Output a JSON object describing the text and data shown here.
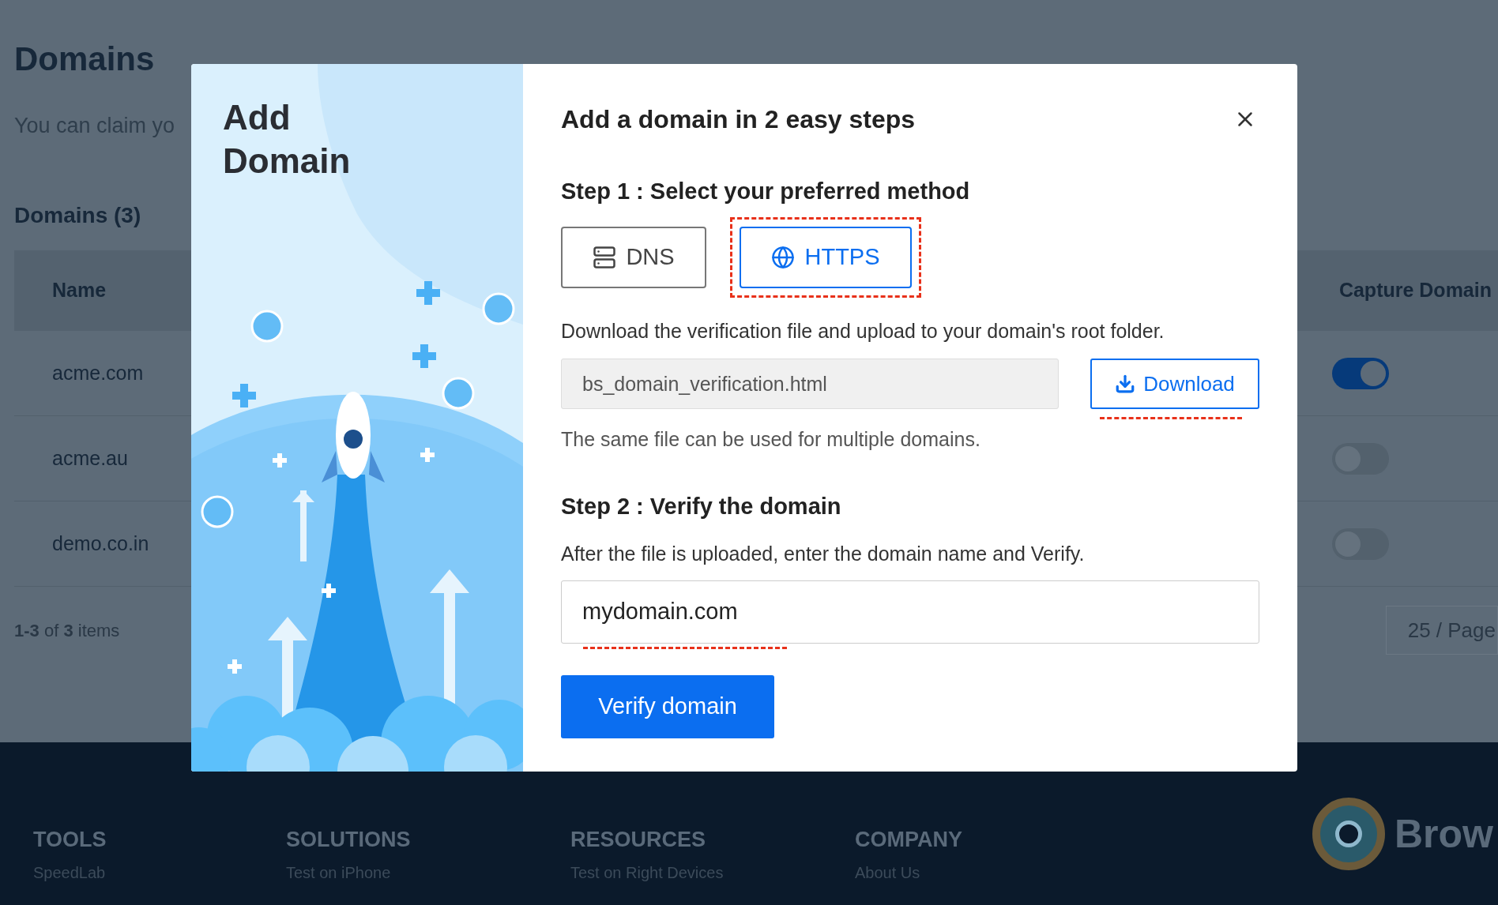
{
  "page": {
    "title": "Domains",
    "intro": "You can claim yo",
    "section_title": "Domains (3)"
  },
  "table": {
    "columns": [
      "Name",
      "Capture Domain"
    ],
    "rows": [
      {
        "name": "acme.com",
        "capture_on": true
      },
      {
        "name": "acme.au",
        "capture_on": false
      },
      {
        "name": "demo.co.in",
        "capture_on": false
      }
    ]
  },
  "pagination": {
    "summary": "**1-3** of **3** items",
    "page_size": "25 / Page"
  },
  "footer": {
    "columns": [
      {
        "heading": "TOOLS",
        "link": "SpeedLab"
      },
      {
        "heading": "SOLUTIONS",
        "link": "Test on iPhone"
      },
      {
        "heading": "RESOURCES",
        "link": "Test on Right Devices"
      },
      {
        "heading": "COMPANY",
        "link": "About Us"
      }
    ],
    "brand": "Brow"
  },
  "dialog": {
    "side_title": "Add Domain",
    "title": "Add a domain in 2 easy steps",
    "step1": {
      "title": "Step 1 : Select your preferred method",
      "methods": [
        {
          "label": "DNS",
          "kind": "server",
          "selected": false
        },
        {
          "label": "HTTPS",
          "kind": "globe",
          "selected": true
        }
      ],
      "description": "Download the verification file and upload to your domain's root folder.",
      "file_name": "bs_domain_verification.html",
      "download_button": "Download",
      "note": "The same file can be used for multiple domains."
    },
    "step2": {
      "title": "Step 2 : Verify the domain",
      "description": "After the file is uploaded, enter the domain name and Verify.",
      "domain_value": "mydomain.com",
      "verify_button": "Verify domain"
    }
  }
}
